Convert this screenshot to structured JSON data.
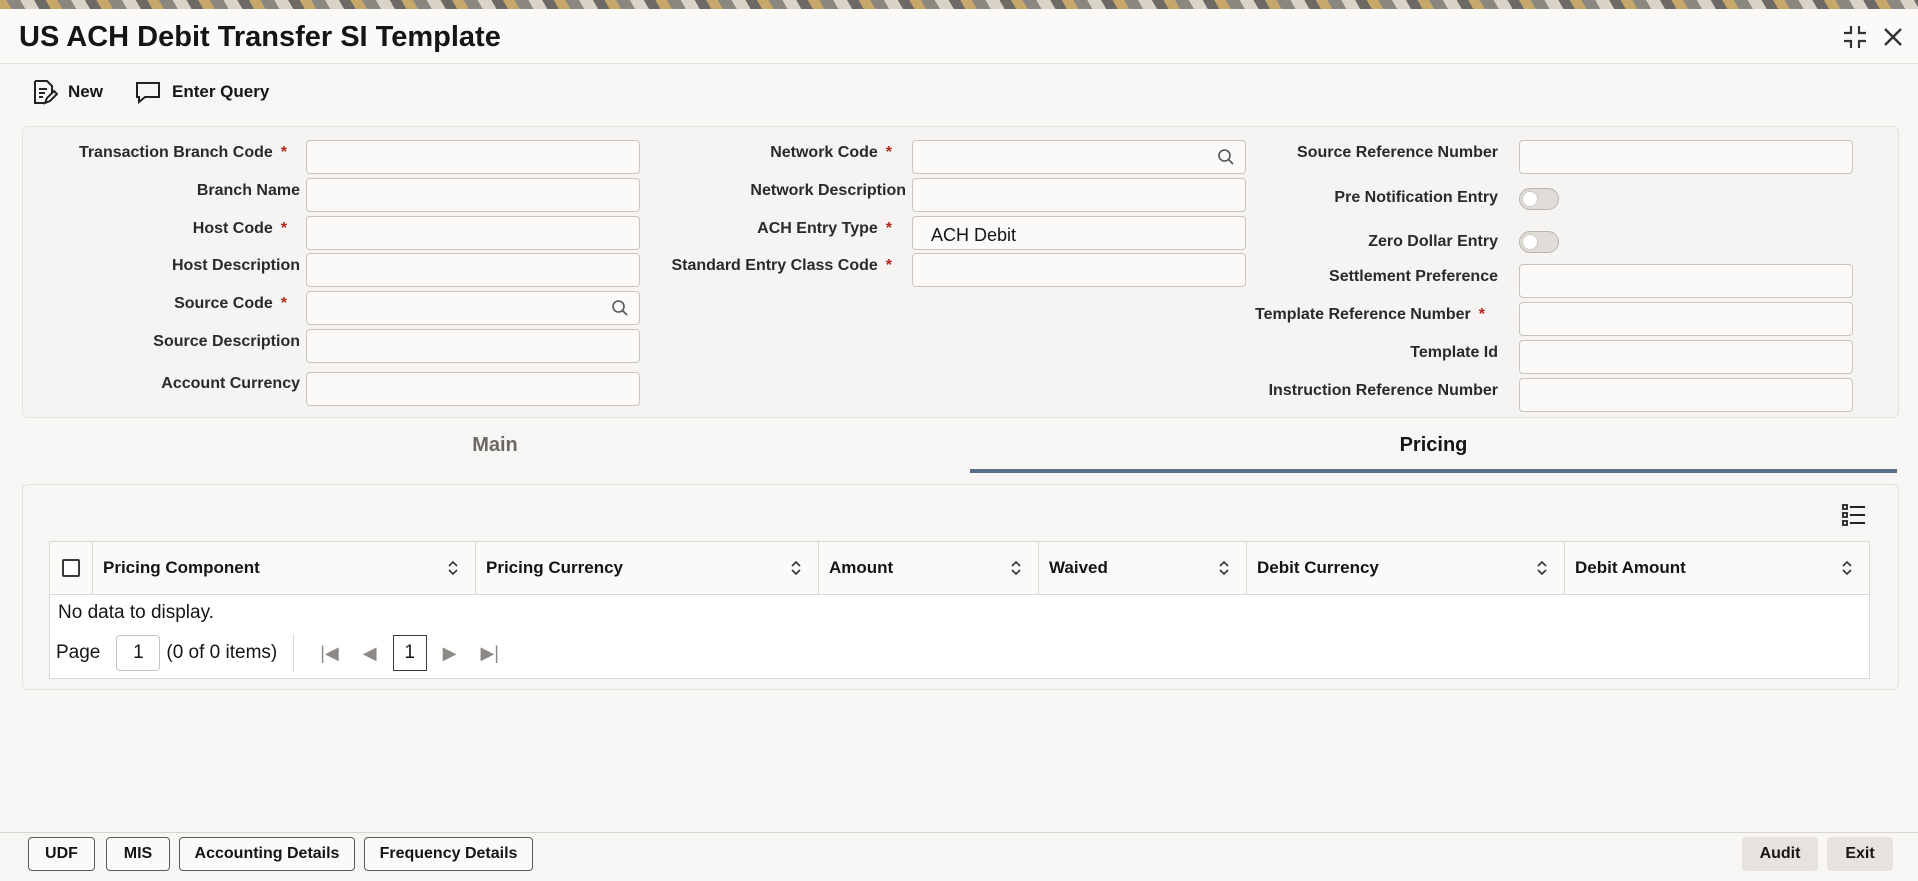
{
  "window": {
    "title": "US ACH Debit Transfer SI Template",
    "restore_icon": "restore-icon",
    "close_icon": "close-icon"
  },
  "toolbar": {
    "new_label": "New",
    "enter_query_label": "Enter Query"
  },
  "form": {
    "transaction_branch_code": {
      "label": "Transaction Branch Code",
      "value": ""
    },
    "branch_name": {
      "label": "Branch Name",
      "value": ""
    },
    "host_code": {
      "label": "Host Code",
      "value": ""
    },
    "host_description": {
      "label": "Host Description",
      "value": ""
    },
    "source_code": {
      "label": "Source Code",
      "value": ""
    },
    "source_description": {
      "label": "Source Description",
      "value": ""
    },
    "account_currency": {
      "label": "Account Currency",
      "value": ""
    },
    "network_code": {
      "label": "Network Code",
      "value": ""
    },
    "network_description": {
      "label": "Network Description",
      "value": ""
    },
    "ach_entry_type": {
      "label": "ACH Entry Type",
      "value": "ACH Debit"
    },
    "standard_entry_class_code": {
      "label": "Standard Entry Class Code",
      "value": ""
    },
    "source_reference_number": {
      "label": "Source Reference Number",
      "value": ""
    },
    "pre_notification_entry": {
      "label": "Pre Notification Entry",
      "checked": false
    },
    "zero_dollar_entry": {
      "label": "Zero Dollar Entry",
      "checked": false
    },
    "settlement_preference": {
      "label": "Settlement Preference",
      "value": ""
    },
    "template_reference_number": {
      "label": "Template Reference Number",
      "value": ""
    },
    "template_id": {
      "label": "Template Id",
      "value": ""
    },
    "instruction_reference_number": {
      "label": "Instruction Reference Number",
      "value": ""
    },
    "required_mark": "*"
  },
  "tabs": [
    {
      "label": "Main",
      "active": false
    },
    {
      "label": "Pricing",
      "active": true
    }
  ],
  "pricing_table": {
    "columns": [
      "Pricing Component",
      "Pricing Currency",
      "Amount",
      "Waived",
      "Debit Currency",
      "Debit Amount"
    ],
    "rows": [],
    "empty_text": "No data to display.",
    "pager": {
      "page_label": "Page",
      "page_value": "1",
      "items_text": "(0 of 0 items)",
      "current_page": "1"
    }
  },
  "footer": {
    "buttons": [
      "UDF",
      "MIS",
      "Accounting Details",
      "Frequency Details"
    ],
    "audit_label": "Audit",
    "exit_label": "Exit"
  }
}
